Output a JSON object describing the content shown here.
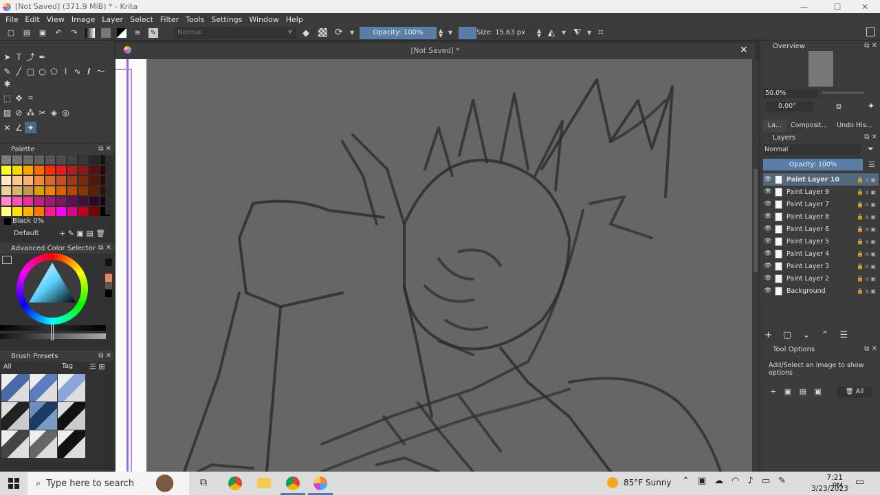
{
  "window": {
    "title": "[Not Saved]  (371.9 MiB)  * - Krita",
    "controls": {
      "minimize": "—",
      "maximize": "☐",
      "close": "✕"
    }
  },
  "menu": [
    "File",
    "Edit",
    "View",
    "Image",
    "Layer",
    "Select",
    "Filter",
    "Tools",
    "Settings",
    "Window",
    "Help"
  ],
  "toolbar": {
    "blend_mode": "Normal",
    "opacity_label": "Opacity: 100%",
    "size_label": "Size: 15.63 px",
    "size_value_fraction": 0.23
  },
  "palette": {
    "title": "Palette",
    "current_color": "Black 0%",
    "set_name": "Default",
    "swatches": [
      "#7d7d7d",
      "#747474",
      "#6a6a6a",
      "#616161",
      "#575757",
      "#4d4d4d",
      "#424242",
      "#363636",
      "#272727",
      "#141414",
      "#ffff20",
      "#ffd800",
      "#ffa500",
      "#ff6a00",
      "#ff3000",
      "#e81d1d",
      "#b41d1d",
      "#8a1a1a",
      "#5a1010",
      "#2b0808",
      "#ffe8c4",
      "#ffc890",
      "#ffb070",
      "#f08a40",
      "#d86a2a",
      "#c05020",
      "#9a3a18",
      "#782a10",
      "#501808",
      "#2a0c04",
      "#e8d49a",
      "#d4b86a",
      "#c09a48",
      "#d8a000",
      "#e8820a",
      "#d86000",
      "#b44800",
      "#8a3400",
      "#5a2000",
      "#301000",
      "#ff8ad0",
      "#ff50b8",
      "#e8309a",
      "#c02080",
      "#a01870",
      "#801860",
      "#601050",
      "#401038",
      "#300828",
      "#180414",
      "#ffff80",
      "#ffe000",
      "#ffb000",
      "#ff7800",
      "#ff1a8a",
      "#ff00ff",
      "#e0008a",
      "#c00020",
      "#7a0000",
      "#000000"
    ]
  },
  "advanced_color_selector": {
    "title": "Advanced Color Selector"
  },
  "brush_presets": {
    "title": "Brush Presets",
    "filter": "All",
    "tag": "Tag"
  },
  "canvas": {
    "doc_title": "[Not Saved]  *"
  },
  "overview": {
    "title": "Overview",
    "zoom": "50.0%",
    "rotation": "0.00°"
  },
  "tabs": [
    "La...",
    "Composit...",
    "Undo His..."
  ],
  "layers": {
    "title": "Layers",
    "blend_mode": "Normal",
    "opacity_label": "Opacity:  100%",
    "items": [
      {
        "name": "Paint Layer 10",
        "selected": true
      },
      {
        "name": "Paint Layer 9",
        "selected": false
      },
      {
        "name": "Paint Layer 7",
        "selected": false
      },
      {
        "name": "Paint Layer 8",
        "selected": false
      },
      {
        "name": "Paint Layer 6",
        "selected": false
      },
      {
        "name": "Paint Layer 5",
        "selected": false
      },
      {
        "name": "Paint Layer 4",
        "selected": false
      },
      {
        "name": "Paint Layer 3",
        "selected": false
      },
      {
        "name": "Paint Layer 2",
        "selected": false
      },
      {
        "name": "Background",
        "selected": false
      }
    ]
  },
  "tool_options": {
    "title": "Tool Options",
    "message": "Add/Select an image to show options",
    "all_button": "All"
  },
  "taskbar": {
    "search_placeholder": "Type here to search",
    "weather": "85°F  Sunny",
    "time": "7:21 PM",
    "date": "3/23/2023"
  },
  "colors": {
    "accent": "#5a7fa6",
    "panel_bg": "#3b3b3b",
    "canvas_bg": "#666666"
  }
}
